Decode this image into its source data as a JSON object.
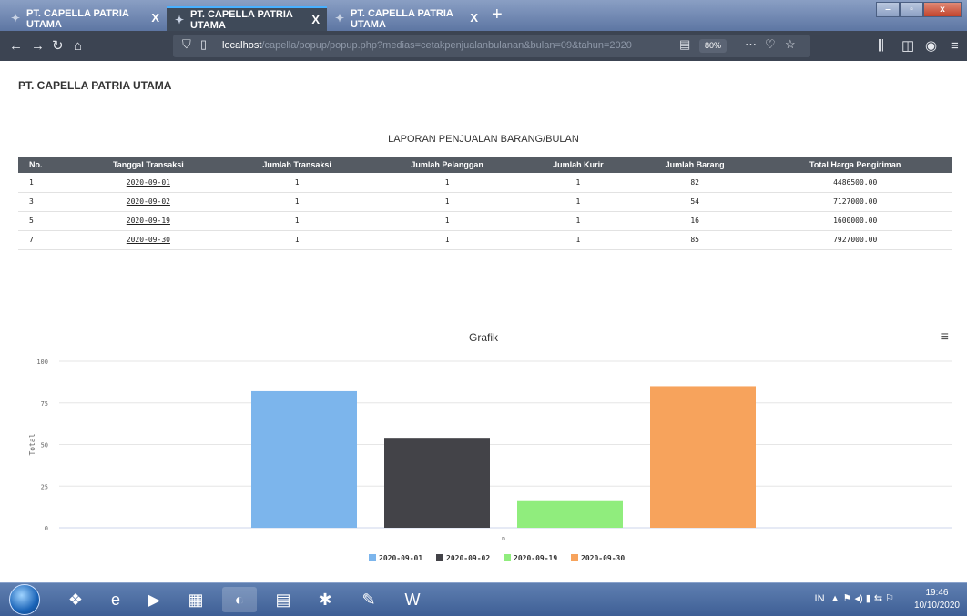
{
  "browser": {
    "tabs": [
      {
        "title": "PT. CAPELLA PATRIA UTAMA",
        "close": "X"
      },
      {
        "title": "PT. CAPELLA PATRIA UTAMA",
        "close": "X"
      },
      {
        "title": "PT. CAPELLA PATRIA UTAMA",
        "close": "X"
      }
    ],
    "new_tab": "+",
    "url_host": "localhost",
    "url_path": "/capella/popup/popup.php?medias=cetakpenjualanbulanan&bulan=09&tahun=2020",
    "zoom": "80%",
    "window_controls": {
      "min": "–",
      "max": "▫",
      "close": "x"
    }
  },
  "page": {
    "company": "PT. CAPELLA PATRIA UTAMA",
    "report_title": "LAPORAN PENJUALAN BARANG/BULAN",
    "table": {
      "headers": [
        "No.",
        "Tanggal Transaksi",
        "Jumlah Transaksi",
        "Jumlah Pelanggan",
        "Jumlah Kurir",
        "Jumlah Barang",
        "Total Harga Pengiriman"
      ],
      "rows": [
        [
          "1",
          "2020-09-01",
          "1",
          "1",
          "1",
          "82",
          "4486500.00"
        ],
        [
          "3",
          "2020-09-02",
          "1",
          "1",
          "1",
          "54",
          "7127000.00"
        ],
        [
          "5",
          "2020-09-19",
          "1",
          "1",
          "1",
          "16",
          "1600000.00"
        ],
        [
          "7",
          "2020-09-30",
          "1",
          "1",
          "1",
          "85",
          "7927000.00"
        ]
      ]
    }
  },
  "chart_data": {
    "type": "bar",
    "title": "Grafik",
    "xlabel": "",
    "ylabel": "Total",
    "category_label": "n",
    "yticks": [
      0,
      25,
      50,
      75,
      100
    ],
    "ylim": [
      0,
      100
    ],
    "grid": true,
    "legend_position": "bottom",
    "series": [
      {
        "name": "2020-09-01",
        "values": [
          82
        ],
        "color": "#7cb5ec"
      },
      {
        "name": "2020-09-02",
        "values": [
          54
        ],
        "color": "#434348"
      },
      {
        "name": "2020-09-19",
        "values": [
          16
        ],
        "color": "#90ed7d"
      },
      {
        "name": "2020-09-30",
        "values": [
          85
        ],
        "color": "#f7a35c"
      }
    ],
    "menu_icon": "hamburger-menu-icon"
  },
  "taskbar": {
    "clock_time": "19:46",
    "clock_date": "10/10/2020",
    "tray_text": "IN"
  }
}
